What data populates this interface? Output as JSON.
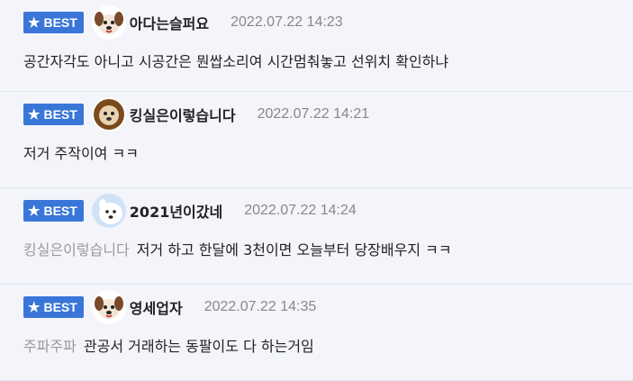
{
  "badge_label": "BEST",
  "comments": [
    {
      "nickname": "아다는슬퍼요",
      "date": "2022.07.22 14:23",
      "mention": "",
      "text": "공간자각도 아니고 시공간은 뭔쌉소리여 시간멈춰놓고 선위치 확인하냐",
      "avatar": "dog-avatar"
    },
    {
      "nickname": "킹실은이렇습니다",
      "date": "2022.07.22 14:21",
      "mention": "",
      "text": "저거 주작이여 ㅋㅋ",
      "avatar": "lion-avatar"
    },
    {
      "nickname": "2021년이갔네",
      "date": "2022.07.22 14:24",
      "mention": "킹실은이렇습니다",
      "text": "저거 하고 한달에 3천이면 오늘부터 당장배우지 ㅋㅋ",
      "avatar": "white-dog-avatar"
    },
    {
      "nickname": "영세업자",
      "date": "2022.07.22 14:35",
      "mention": "주파주파",
      "text": "관공서 거래하는 동팔이도 다 하는거임",
      "avatar": "dog-avatar"
    }
  ],
  "colors": {
    "badge": "#3a76d8",
    "mention": "#9a9a9a",
    "date": "#888888",
    "background": "#f3f5fa"
  }
}
